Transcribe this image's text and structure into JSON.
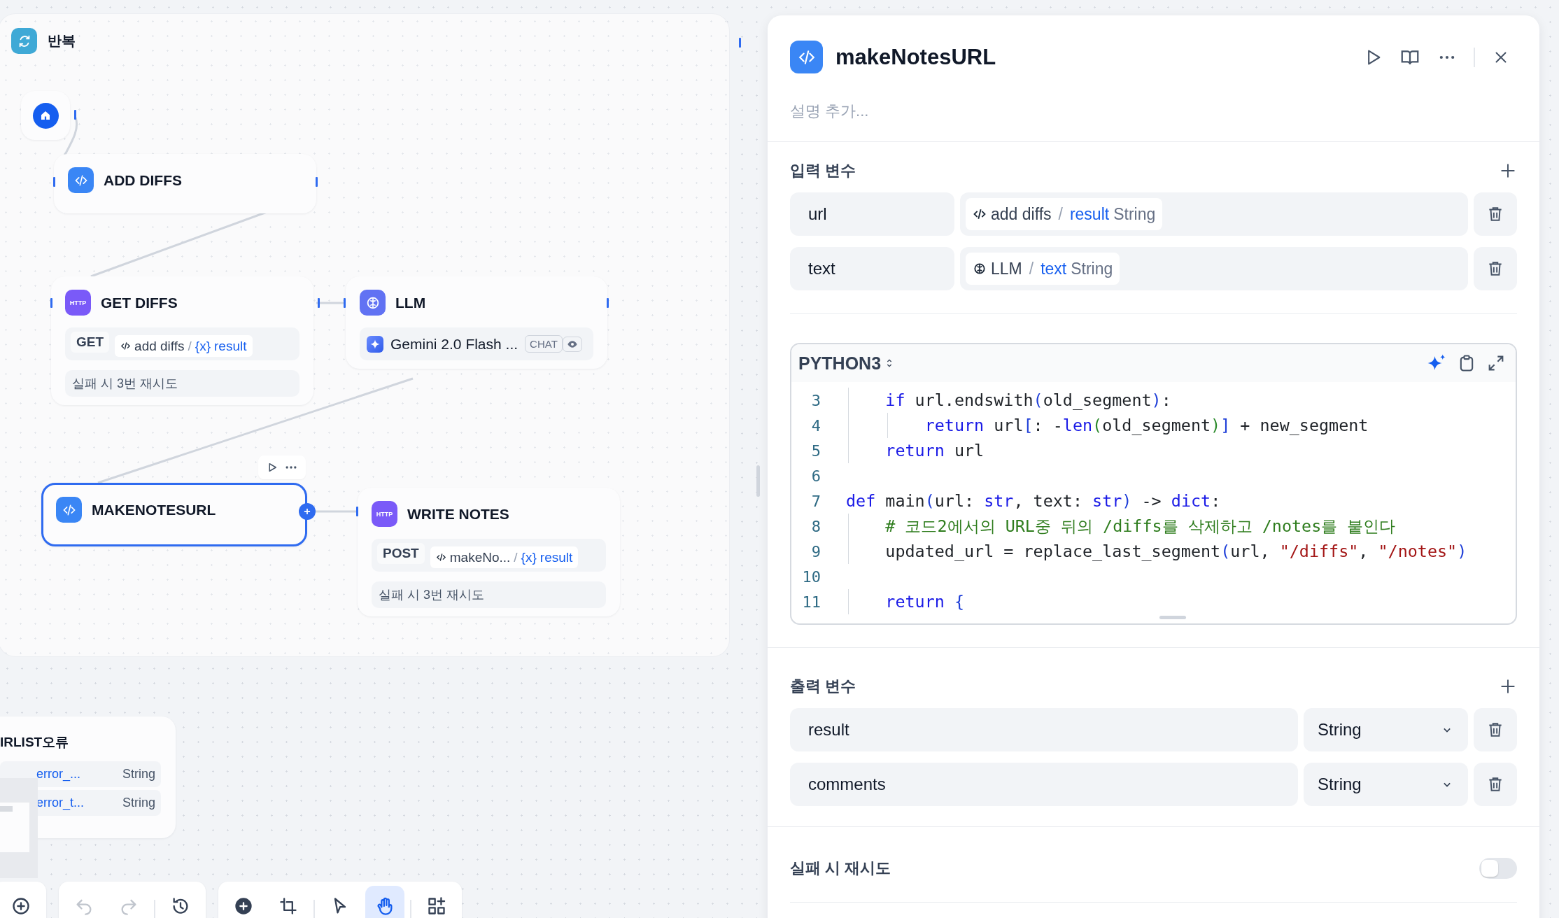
{
  "canvas": {
    "loop": {
      "title": "반복"
    },
    "nodes": [
      {
        "kind": "start",
        "selected": false
      },
      {
        "kind": "code",
        "title": "ADD DIFFS",
        "selected": false
      },
      {
        "kind": "http",
        "icon_label": "HTTP",
        "title": "GET DIFFS",
        "method": "GET",
        "source": "add diffs",
        "separator": "/",
        "variable_marker": "{x}",
        "variable": "result",
        "retry": "실패 시 3번 재시도",
        "selected": false
      },
      {
        "kind": "llm",
        "title": "LLM",
        "model": "Gemini 2.0 Flash ...",
        "mode": "CHAT",
        "selected": false
      },
      {
        "kind": "code",
        "title": "MAKENOTESURL",
        "selected": true
      },
      {
        "kind": "http",
        "icon_label": "HTTP",
        "title": "WRITE NOTES",
        "method": "POST",
        "source": "makeNo...",
        "separator": "/",
        "variable_marker": "{x}",
        "variable": "result",
        "retry": "실패 시 3번 재시도",
        "selected": false
      }
    ],
    "partial_node": {
      "title": "IRLIST오류",
      "outputs": [
        {
          "name": "error_...",
          "type": "String"
        },
        {
          "name": "error_t...",
          "type": "String"
        }
      ]
    },
    "toolbars": [
      {
        "sections": [
          {
            "tools": [
              {
                "kind": "zoom_in",
                "selected": false,
                "disabled": false
              }
            ]
          }
        ]
      },
      {
        "sections": [
          {
            "tools": [
              {
                "kind": "undo",
                "selected": false,
                "disabled": true
              },
              {
                "kind": "redo",
                "selected": false,
                "disabled": true
              }
            ]
          },
          {
            "tools": [
              {
                "kind": "history",
                "selected": false,
                "disabled": false
              }
            ]
          }
        ]
      },
      {
        "sections": [
          {
            "tools": [
              {
                "kind": "add",
                "selected": false,
                "disabled": false
              },
              {
                "kind": "connect",
                "selected": false,
                "disabled": false
              }
            ]
          },
          {
            "tools": [
              {
                "kind": "pointer",
                "selected": false,
                "disabled": false
              },
              {
                "kind": "hand",
                "selected": true,
                "disabled": false
              }
            ]
          },
          {
            "tools": [
              {
                "kind": "organize",
                "selected": false,
                "disabled": false
              }
            ]
          }
        ]
      }
    ]
  },
  "panel": {
    "title": "makeNotesURL",
    "description": {
      "placeholder": "설명 추가..."
    },
    "inputs": {
      "title": "입력 변수",
      "variables": [
        {
          "name": "url",
          "kind": "code",
          "source": "add diffs",
          "separator": "/",
          "field": "result",
          "type": "String"
        },
        {
          "name": "text",
          "kind": "llm",
          "source": "LLM",
          "separator": "/",
          "field": "text",
          "type": "String"
        }
      ]
    },
    "code": {
      "language": "PYTHON3",
      "lines": [
        {
          "number": "3",
          "tokens": [
            {
              "kind": "keyword",
              "text": "    if"
            },
            {
              "kind": "plain",
              "text": " url.endswith"
            },
            {
              "kind": "bracket",
              "text": "("
            },
            {
              "kind": "plain",
              "text": "old_segment"
            },
            {
              "kind": "bracket",
              "text": ")"
            },
            {
              "kind": "plain",
              "text": ":"
            }
          ]
        },
        {
          "number": "4",
          "tokens": [
            {
              "kind": "keyword",
              "text": "        return"
            },
            {
              "kind": "plain",
              "text": " url"
            },
            {
              "kind": "bracket",
              "text": "["
            },
            {
              "kind": "plain",
              "text": ": -"
            },
            {
              "kind": "keyword",
              "text": "len"
            },
            {
              "kind": "bracket2",
              "text": "("
            },
            {
              "kind": "plain",
              "text": "old_segment"
            },
            {
              "kind": "bracket2",
              "text": ")"
            },
            {
              "kind": "bracket",
              "text": "]"
            },
            {
              "kind": "plain",
              "text": " + new_segment"
            }
          ]
        },
        {
          "number": "5",
          "tokens": [
            {
              "kind": "keyword",
              "text": "    return"
            },
            {
              "kind": "plain",
              "text": " url"
            }
          ]
        },
        {
          "number": "6"
        },
        {
          "number": "7",
          "tokens": [
            {
              "kind": "keyword",
              "text": "def"
            },
            {
              "kind": "plain",
              "text": " main"
            },
            {
              "kind": "bracket",
              "text": "("
            },
            {
              "kind": "plain",
              "text": "url: "
            },
            {
              "kind": "keyword",
              "text": "str"
            },
            {
              "kind": "plain",
              "text": ", text: "
            },
            {
              "kind": "keyword",
              "text": "str"
            },
            {
              "kind": "bracket",
              "text": ")"
            },
            {
              "kind": "plain",
              "text": " -> "
            },
            {
              "kind": "keyword",
              "text": "dict"
            },
            {
              "kind": "plain",
              "text": ":"
            }
          ]
        },
        {
          "number": "8",
          "tokens": [
            {
              "kind": "comment",
              "text": "    # 코드2에서의 URL중 뒤의 /diffs를 삭제하고 /notes를 붙인다"
            }
          ]
        },
        {
          "number": "9",
          "tokens": [
            {
              "kind": "plain",
              "text": "    updated_url = replace_last_segment"
            },
            {
              "kind": "bracket",
              "text": "("
            },
            {
              "kind": "plain",
              "text": "url, "
            },
            {
              "kind": "string",
              "text": "\"/diffs\""
            },
            {
              "kind": "plain",
              "text": ", "
            },
            {
              "kind": "string",
              "text": "\"/notes\""
            },
            {
              "kind": "bracket",
              "text": ")"
            }
          ]
        },
        {
          "number": "10"
        },
        {
          "number": "11",
          "tokens": [
            {
              "kind": "keyword",
              "text": "    return"
            },
            {
              "kind": "bracket",
              "text": " {"
            }
          ]
        }
      ]
    },
    "outputs": {
      "title": "출력 변수",
      "variables": [
        {
          "name": "result",
          "type": "String"
        },
        {
          "name": "comments",
          "type": "String"
        }
      ]
    },
    "retry": {
      "label": "실패 시 재시도",
      "on": false
    }
  }
}
